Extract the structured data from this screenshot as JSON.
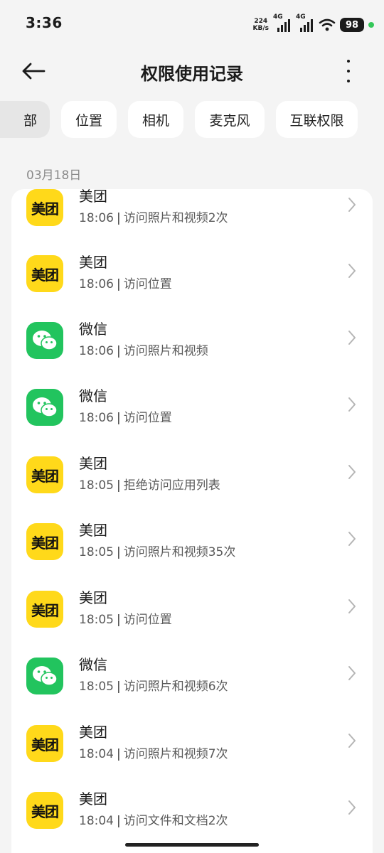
{
  "status": {
    "time": "3:36",
    "netspeed_value": "224",
    "netspeed_unit": "KB/s",
    "network1": "4G",
    "network2": "4G",
    "battery": "98",
    "colors": {
      "active_dot": "#34c759"
    }
  },
  "header": {
    "title": "权限使用记录"
  },
  "filters": {
    "partial_label": "部",
    "chips": [
      "位置",
      "相机",
      "麦克风",
      "互联权限"
    ]
  },
  "date_label": "03月18日",
  "app_labels": {
    "meituan_icon_text": "美团"
  },
  "records": [
    {
      "app": "美团",
      "icon": "meituan",
      "time": "18:06",
      "action": "访问照片和视频2次"
    },
    {
      "app": "美团",
      "icon": "meituan",
      "time": "18:06",
      "action": "访问位置"
    },
    {
      "app": "微信",
      "icon": "wechat",
      "time": "18:06",
      "action": "访问照片和视频"
    },
    {
      "app": "微信",
      "icon": "wechat",
      "time": "18:06",
      "action": "访问位置"
    },
    {
      "app": "美团",
      "icon": "meituan",
      "time": "18:05",
      "action": "拒绝访问应用列表"
    },
    {
      "app": "美团",
      "icon": "meituan",
      "time": "18:05",
      "action": "访问照片和视频35次"
    },
    {
      "app": "美团",
      "icon": "meituan",
      "time": "18:05",
      "action": "访问位置"
    },
    {
      "app": "微信",
      "icon": "wechat",
      "time": "18:05",
      "action": "访问照片和视频6次"
    },
    {
      "app": "美团",
      "icon": "meituan",
      "time": "18:04",
      "action": "访问照片和视频7次"
    },
    {
      "app": "美团",
      "icon": "meituan",
      "time": "18:04",
      "action": "访问文件和文档2次"
    }
  ],
  "colors": {
    "meituan": "#ffd91a",
    "wechat": "#22c45e",
    "background": "#f4f4f4"
  }
}
